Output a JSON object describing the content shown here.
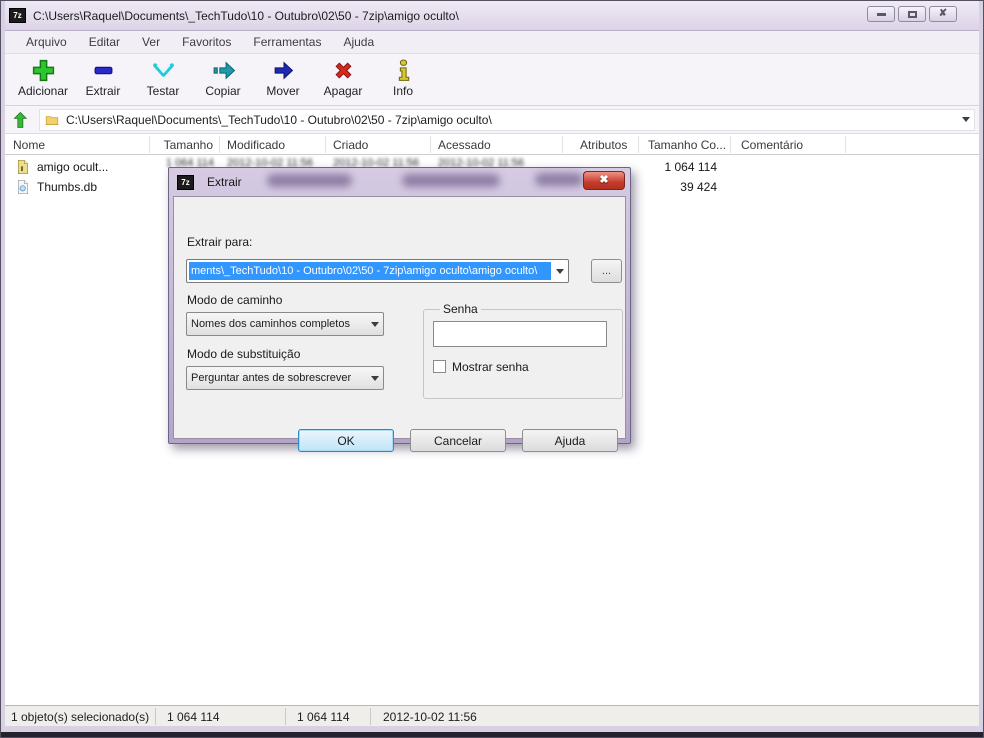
{
  "window": {
    "title": "C:\\Users\\Raquel\\Documents\\_TechTudo\\10 - Outubro\\02\\50 - 7zip\\amigo oculto\\",
    "app_icon_text": "7z"
  },
  "menu": {
    "items": [
      "Arquivo",
      "Editar",
      "Ver",
      "Favoritos",
      "Ferramentas",
      "Ajuda"
    ]
  },
  "toolbar": {
    "buttons": [
      {
        "label": "Adicionar",
        "icon": "add-plus-icon"
      },
      {
        "label": "Extrair",
        "icon": "extract-minus-icon"
      },
      {
        "label": "Testar",
        "icon": "test-check-icon"
      },
      {
        "label": "Copiar",
        "icon": "copy-arrow-icon"
      },
      {
        "label": "Mover",
        "icon": "move-arrow-icon"
      },
      {
        "label": "Apagar",
        "icon": "delete-x-icon"
      },
      {
        "label": "Info",
        "icon": "info-icon"
      }
    ]
  },
  "addressbar": {
    "path": "C:\\Users\\Raquel\\Documents\\_TechTudo\\10 - Outubro\\02\\50 - 7zip\\amigo oculto\\"
  },
  "filelist": {
    "columns": [
      "Nome",
      "Tamanho",
      "Modificado",
      "Criado",
      "Acessado",
      "Atributos",
      "Tamanho Co...",
      "Comentário"
    ],
    "rows": [
      {
        "name": "amigo ocult...",
        "icon": "archive-file-icon",
        "tamanho": "1 064 114",
        "modificado": "2012-10-02 11:56",
        "criado": "2012-10-02 11:56",
        "acessado": "2012-10-02 11:56",
        "tamanho_comprimido": "1 064 114"
      },
      {
        "name": "Thumbs.db",
        "icon": "thumbs-db-file-icon",
        "tamanho_comprimido": "39 424"
      }
    ]
  },
  "dialog": {
    "title": "Extrair",
    "extract_to_label": "Extrair para:",
    "path_value": "ments\\_TechTudo\\10 - Outubro\\02\\50 - 7zip\\amigo oculto\\amigo oculto\\",
    "browse_label": "...",
    "path_mode_label": "Modo de caminho",
    "path_mode_value": "Nomes dos caminhos completos",
    "overwrite_mode_label": "Modo de substituição",
    "overwrite_mode_value": "Perguntar antes de sobrescrever",
    "password_group_label": "Senha",
    "password_value": "",
    "show_password_label": "Mostrar senha",
    "ok_label": "OK",
    "cancel_label": "Cancelar",
    "help_label": "Ajuda"
  },
  "statusbar": {
    "selected": "1 objeto(s) selecionado(s)",
    "size_a": "1 064 114",
    "size_b": "1 064 114",
    "datetime": "2012-10-02 11:56"
  },
  "colors": {
    "selection_blue": "#3296ff",
    "close_red": "#c53c2c",
    "add_green": "#2ec62e",
    "move_navy": "#1c2bb0",
    "copy_teal": "#1f9aa8",
    "delete_red": "#d42a1e",
    "info_yellow": "#d8c82a",
    "frame_lavender": "#d9d0e4"
  }
}
